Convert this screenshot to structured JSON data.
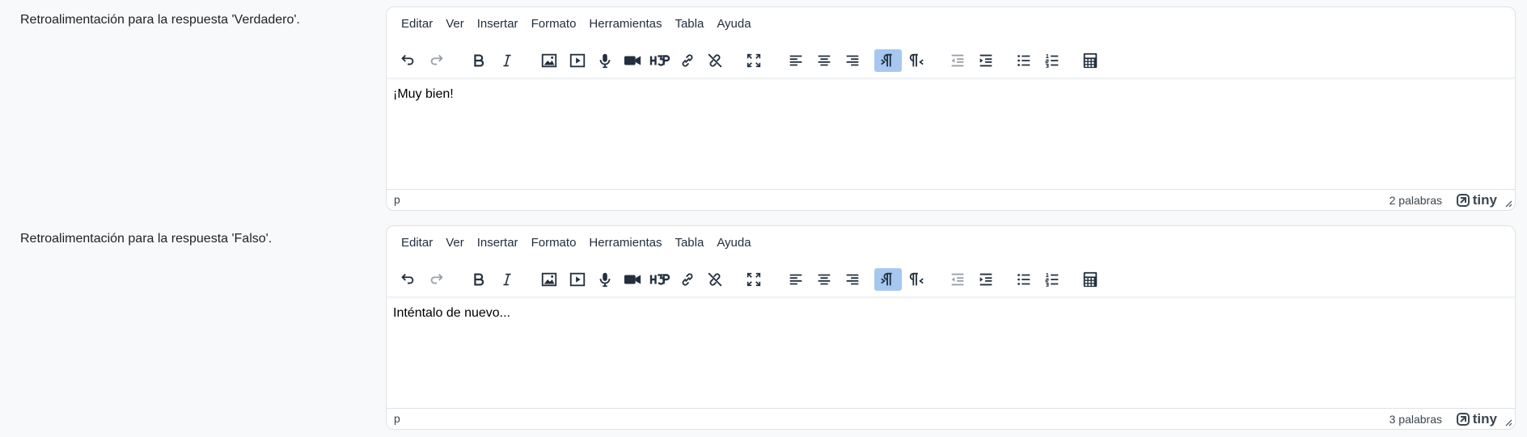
{
  "menus": [
    "Editar",
    "Ver",
    "Insertar",
    "Formato",
    "Herramientas",
    "Tabla",
    "Ayuda"
  ],
  "toolbar_icons": [
    "undo-icon",
    "redo-icon",
    "bold-icon",
    "italic-icon",
    "image-icon",
    "media-icon",
    "microphone-icon",
    "video-camera-icon",
    "h5p-icon",
    "link-icon",
    "unlink-icon",
    "fullscreen-icon",
    "align-left-icon",
    "align-center-icon",
    "align-right-icon",
    "ltr-icon",
    "rtl-icon",
    "outdent-icon",
    "indent-icon",
    "bullet-list-icon",
    "numbered-list-icon",
    "calculator-icon"
  ],
  "colors": {
    "active_button": "#a6c8f0",
    "background": "#f8f9fa",
    "editor_border": "#dee2e6"
  },
  "fields": [
    {
      "label": "Retroalimentación para la respuesta 'Verdadero'.",
      "content": "¡Muy bien!",
      "path": "p",
      "wordcount": "2 palabras",
      "brand": "tiny"
    },
    {
      "label": "Retroalimentación para la respuesta 'Falso'.",
      "content": "Inténtalo de nuevo...",
      "path": "p",
      "wordcount": "3 palabras",
      "brand": "tiny"
    }
  ]
}
